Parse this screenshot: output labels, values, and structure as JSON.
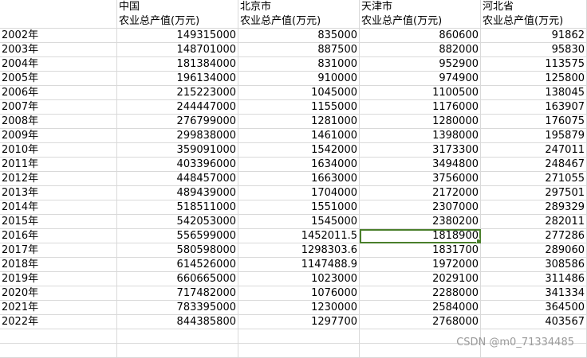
{
  "sheet": {
    "header_regions": [
      "",
      "中国",
      "北京市",
      "天津市",
      "河北省"
    ],
    "header_metric": [
      "",
      "农业总产值(万元)",
      "农业总产值(万元)",
      "农业总产值(万元)",
      "农业总产值(万元)"
    ],
    "rows": [
      [
        "2002年",
        "149315000",
        "835000",
        "860600",
        "91862"
      ],
      [
        "2003年",
        "148701000",
        "887500",
        "882000",
        "95830"
      ],
      [
        "2004年",
        "181384000",
        "831000",
        "952900",
        "113575"
      ],
      [
        "2005年",
        "196134000",
        "910000",
        "974900",
        "125800"
      ],
      [
        "2006年",
        "215223000",
        "1045000",
        "1100500",
        "138045"
      ],
      [
        "2007年",
        "244447000",
        "1155000",
        "1176000",
        "163907"
      ],
      [
        "2008年",
        "276799000",
        "1281000",
        "1280000",
        "176075"
      ],
      [
        "2009年",
        "299838000",
        "1461000",
        "1398000",
        "195879"
      ],
      [
        "2010年",
        "359091000",
        "1542000",
        "3173300",
        "247011"
      ],
      [
        "2011年",
        "403396000",
        "1634000",
        "3494800",
        "248467"
      ],
      [
        "2012年",
        "448457000",
        "1663000",
        "3756000",
        "271055"
      ],
      [
        "2013年",
        "489439000",
        "1704000",
        "2172000",
        "297501"
      ],
      [
        "2014年",
        "518511000",
        "1551000",
        "2307000",
        "289329"
      ],
      [
        "2015年",
        "542053000",
        "1545000",
        "2380200",
        "282011"
      ],
      [
        "2016年",
        "556599000",
        "1452011.5",
        "1818900",
        "277286"
      ],
      [
        "2017年",
        "580598000",
        "1298303.6",
        "1831700",
        "289060"
      ],
      [
        "2018年",
        "614526000",
        "1147488.9",
        "1972000",
        "308586"
      ],
      [
        "2019年",
        "660665000",
        "1023000",
        "2029100",
        "311486"
      ],
      [
        "2020年",
        "717482000",
        "1076000",
        "2288000",
        "341334"
      ],
      [
        "2021年",
        "783395000",
        "1230000",
        "2584000",
        "364500"
      ],
      [
        "2022年",
        "844385800",
        "1297700",
        "2768000",
        "403567"
      ]
    ],
    "selected_cell": {
      "row": 14,
      "col": 3
    }
  },
  "watermark": "CSDN @m0_71334485"
}
